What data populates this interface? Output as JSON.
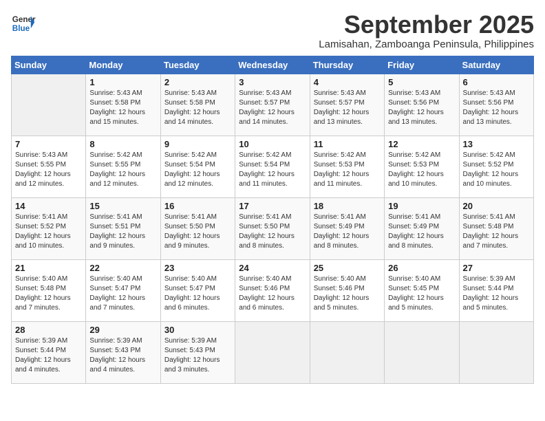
{
  "header": {
    "logo_general": "General",
    "logo_blue": "Blue",
    "month": "September 2025",
    "location": "Lamisahan, Zamboanga Peninsula, Philippines"
  },
  "weekdays": [
    "Sunday",
    "Monday",
    "Tuesday",
    "Wednesday",
    "Thursday",
    "Friday",
    "Saturday"
  ],
  "weeks": [
    [
      {
        "day": "",
        "info": ""
      },
      {
        "day": "1",
        "info": "Sunrise: 5:43 AM\nSunset: 5:58 PM\nDaylight: 12 hours\nand 15 minutes."
      },
      {
        "day": "2",
        "info": "Sunrise: 5:43 AM\nSunset: 5:58 PM\nDaylight: 12 hours\nand 14 minutes."
      },
      {
        "day": "3",
        "info": "Sunrise: 5:43 AM\nSunset: 5:57 PM\nDaylight: 12 hours\nand 14 minutes."
      },
      {
        "day": "4",
        "info": "Sunrise: 5:43 AM\nSunset: 5:57 PM\nDaylight: 12 hours\nand 13 minutes."
      },
      {
        "day": "5",
        "info": "Sunrise: 5:43 AM\nSunset: 5:56 PM\nDaylight: 12 hours\nand 13 minutes."
      },
      {
        "day": "6",
        "info": "Sunrise: 5:43 AM\nSunset: 5:56 PM\nDaylight: 12 hours\nand 13 minutes."
      }
    ],
    [
      {
        "day": "7",
        "info": "Sunrise: 5:43 AM\nSunset: 5:55 PM\nDaylight: 12 hours\nand 12 minutes."
      },
      {
        "day": "8",
        "info": "Sunrise: 5:42 AM\nSunset: 5:55 PM\nDaylight: 12 hours\nand 12 minutes."
      },
      {
        "day": "9",
        "info": "Sunrise: 5:42 AM\nSunset: 5:54 PM\nDaylight: 12 hours\nand 12 minutes."
      },
      {
        "day": "10",
        "info": "Sunrise: 5:42 AM\nSunset: 5:54 PM\nDaylight: 12 hours\nand 11 minutes."
      },
      {
        "day": "11",
        "info": "Sunrise: 5:42 AM\nSunset: 5:53 PM\nDaylight: 12 hours\nand 11 minutes."
      },
      {
        "day": "12",
        "info": "Sunrise: 5:42 AM\nSunset: 5:53 PM\nDaylight: 12 hours\nand 10 minutes."
      },
      {
        "day": "13",
        "info": "Sunrise: 5:42 AM\nSunset: 5:52 PM\nDaylight: 12 hours\nand 10 minutes."
      }
    ],
    [
      {
        "day": "14",
        "info": "Sunrise: 5:41 AM\nSunset: 5:52 PM\nDaylight: 12 hours\nand 10 minutes."
      },
      {
        "day": "15",
        "info": "Sunrise: 5:41 AM\nSunset: 5:51 PM\nDaylight: 12 hours\nand 9 minutes."
      },
      {
        "day": "16",
        "info": "Sunrise: 5:41 AM\nSunset: 5:50 PM\nDaylight: 12 hours\nand 9 minutes."
      },
      {
        "day": "17",
        "info": "Sunrise: 5:41 AM\nSunset: 5:50 PM\nDaylight: 12 hours\nand 8 minutes."
      },
      {
        "day": "18",
        "info": "Sunrise: 5:41 AM\nSunset: 5:49 PM\nDaylight: 12 hours\nand 8 minutes."
      },
      {
        "day": "19",
        "info": "Sunrise: 5:41 AM\nSunset: 5:49 PM\nDaylight: 12 hours\nand 8 minutes."
      },
      {
        "day": "20",
        "info": "Sunrise: 5:41 AM\nSunset: 5:48 PM\nDaylight: 12 hours\nand 7 minutes."
      }
    ],
    [
      {
        "day": "21",
        "info": "Sunrise: 5:40 AM\nSunset: 5:48 PM\nDaylight: 12 hours\nand 7 minutes."
      },
      {
        "day": "22",
        "info": "Sunrise: 5:40 AM\nSunset: 5:47 PM\nDaylight: 12 hours\nand 7 minutes."
      },
      {
        "day": "23",
        "info": "Sunrise: 5:40 AM\nSunset: 5:47 PM\nDaylight: 12 hours\nand 6 minutes."
      },
      {
        "day": "24",
        "info": "Sunrise: 5:40 AM\nSunset: 5:46 PM\nDaylight: 12 hours\nand 6 minutes."
      },
      {
        "day": "25",
        "info": "Sunrise: 5:40 AM\nSunset: 5:46 PM\nDaylight: 12 hours\nand 5 minutes."
      },
      {
        "day": "26",
        "info": "Sunrise: 5:40 AM\nSunset: 5:45 PM\nDaylight: 12 hours\nand 5 minutes."
      },
      {
        "day": "27",
        "info": "Sunrise: 5:39 AM\nSunset: 5:44 PM\nDaylight: 12 hours\nand 5 minutes."
      }
    ],
    [
      {
        "day": "28",
        "info": "Sunrise: 5:39 AM\nSunset: 5:44 PM\nDaylight: 12 hours\nand 4 minutes."
      },
      {
        "day": "29",
        "info": "Sunrise: 5:39 AM\nSunset: 5:43 PM\nDaylight: 12 hours\nand 4 minutes."
      },
      {
        "day": "30",
        "info": "Sunrise: 5:39 AM\nSunset: 5:43 PM\nDaylight: 12 hours\nand 3 minutes."
      },
      {
        "day": "",
        "info": ""
      },
      {
        "day": "",
        "info": ""
      },
      {
        "day": "",
        "info": ""
      },
      {
        "day": "",
        "info": ""
      }
    ]
  ]
}
